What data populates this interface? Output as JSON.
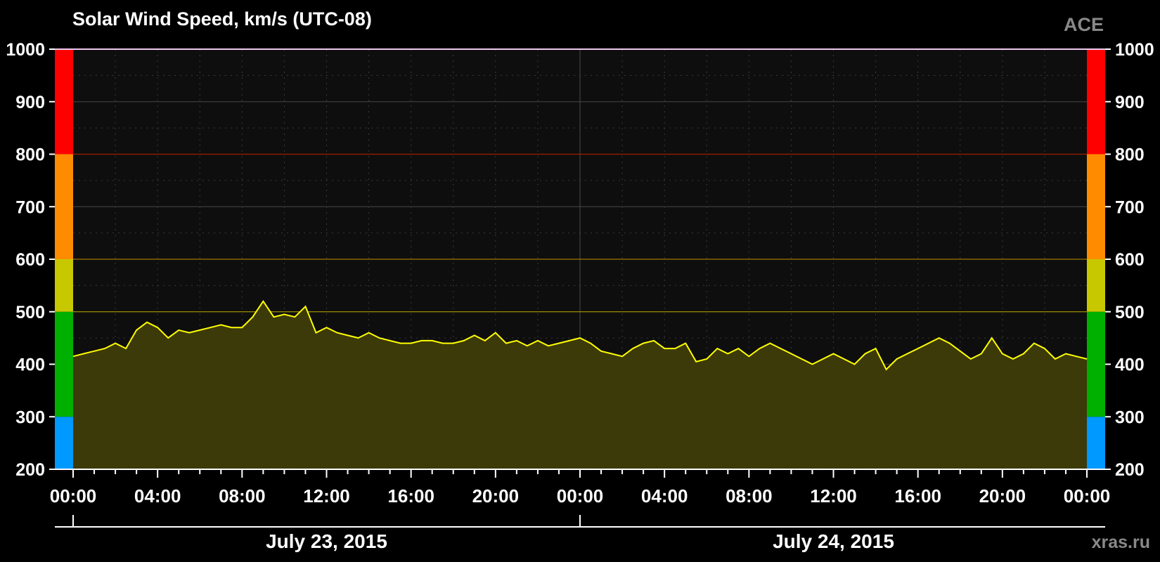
{
  "chart_data": {
    "type": "area",
    "title": "Solar Wind Speed, km/s (UTC-08)",
    "source_label": "ACE",
    "credit": "xras.ru",
    "ylim": [
      200,
      1000
    ],
    "yticks": [
      "1000",
      "900",
      "800",
      "700",
      "600",
      "500",
      "400",
      "300",
      "200"
    ],
    "xlim_hours": [
      0,
      48
    ],
    "xtick_labels": [
      "00:00",
      "04:00",
      "08:00",
      "12:00",
      "16:00",
      "20:00",
      "00:00",
      "04:00",
      "08:00",
      "12:00",
      "16:00",
      "20:00",
      "00:00"
    ],
    "date_labels": [
      "July 23, 2015",
      "July 24, 2015"
    ],
    "threshold_lines": [
      500,
      600,
      800
    ],
    "threshold_colors": [
      "#a09000",
      "#a07800",
      "#a02000"
    ],
    "speed_bands": [
      {
        "from": 200,
        "to": 300,
        "color": "#0099ff"
      },
      {
        "from": 300,
        "to": 500,
        "color": "#00b000"
      },
      {
        "from": 500,
        "to": 600,
        "color": "#c8c800"
      },
      {
        "from": 600,
        "to": 800,
        "color": "#ff8c00"
      },
      {
        "from": 800,
        "to": 1000,
        "color": "#ff0000"
      }
    ],
    "grid": true,
    "series": [
      {
        "color": "#ffff00",
        "fill": "#3d3a0a",
        "x": [
          0,
          0.5,
          1,
          1.5,
          2,
          2.5,
          3,
          3.5,
          4,
          4.5,
          5,
          5.5,
          6,
          6.5,
          7,
          7.5,
          8,
          8.5,
          9,
          9.5,
          10,
          10.5,
          11,
          11.5,
          12,
          12.5,
          13,
          13.5,
          14,
          14.5,
          15,
          15.5,
          16,
          16.5,
          17,
          17.5,
          18,
          18.5,
          19,
          19.5,
          20,
          20.5,
          21,
          21.5,
          22,
          22.5,
          23,
          23.5,
          24,
          24.5,
          25,
          25.5,
          26,
          26.5,
          27,
          27.5,
          28,
          28.5,
          29,
          29.5,
          30,
          30.5,
          31,
          31.5,
          32,
          32.5,
          33,
          33.5,
          34,
          34.5,
          35,
          35.5,
          36,
          36.5,
          37,
          37.5,
          38,
          38.5,
          39,
          39.5,
          40,
          40.5,
          41,
          41.5,
          42,
          42.5,
          43,
          43.5,
          44,
          44.5,
          45,
          45.5,
          46,
          46.5,
          47,
          47.5,
          48
        ],
        "values": [
          415,
          420,
          425,
          430,
          440,
          430,
          465,
          480,
          470,
          450,
          465,
          460,
          465,
          470,
          475,
          470,
          470,
          490,
          520,
          490,
          495,
          490,
          510,
          460,
          470,
          460,
          455,
          450,
          460,
          450,
          445,
          440,
          440,
          445,
          445,
          440,
          440,
          445,
          455,
          445,
          460,
          440,
          445,
          435,
          445,
          435,
          440,
          445,
          450,
          440,
          425,
          420,
          415,
          430,
          440,
          445,
          430,
          430,
          440,
          405,
          410,
          430,
          420,
          430,
          415,
          430,
          440,
          430,
          420,
          410,
          400,
          410,
          420,
          410,
          400,
          420,
          430,
          390,
          410,
          420,
          430,
          440,
          450,
          440,
          425,
          410,
          420,
          450,
          420,
          410,
          420,
          440,
          430,
          410,
          420,
          415,
          410
        ]
      }
    ]
  }
}
